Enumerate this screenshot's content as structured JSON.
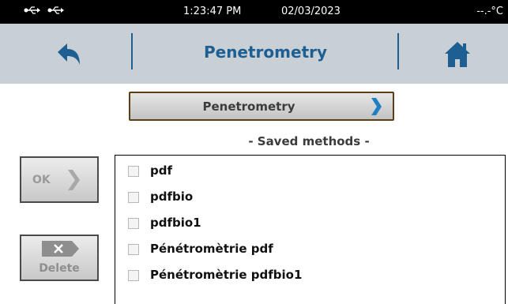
{
  "status_bar": {
    "time": "1:23:47 PM",
    "date": "02/03/2023",
    "temperature": "--.-°C",
    "icons": [
      "usb-icon",
      "usb-icon"
    ]
  },
  "header": {
    "title": "Penetrometry",
    "back_icon": "back-arrow-icon",
    "home_icon": "home-icon",
    "accent_color": "#1d5f92"
  },
  "method_selector": {
    "label": "Penetrometry",
    "icon": "chevron-right-icon",
    "chevron_color": "#1e7fc4"
  },
  "saved_methods": {
    "title": "- Saved methods -",
    "items": [
      {
        "label": "pdf",
        "checked": false
      },
      {
        "label": "pdfbio",
        "checked": false
      },
      {
        "label": "pdfbio1",
        "checked": false
      },
      {
        "label": "Pénétromètrie pdf",
        "checked": false
      },
      {
        "label": "Pénétromètrie pdfbio1",
        "checked": false
      }
    ]
  },
  "buttons": {
    "ok_label": "OK",
    "ok_icon": "chevron-right-icon",
    "delete_label": "Delete",
    "delete_icon": "delete-x-icon"
  }
}
